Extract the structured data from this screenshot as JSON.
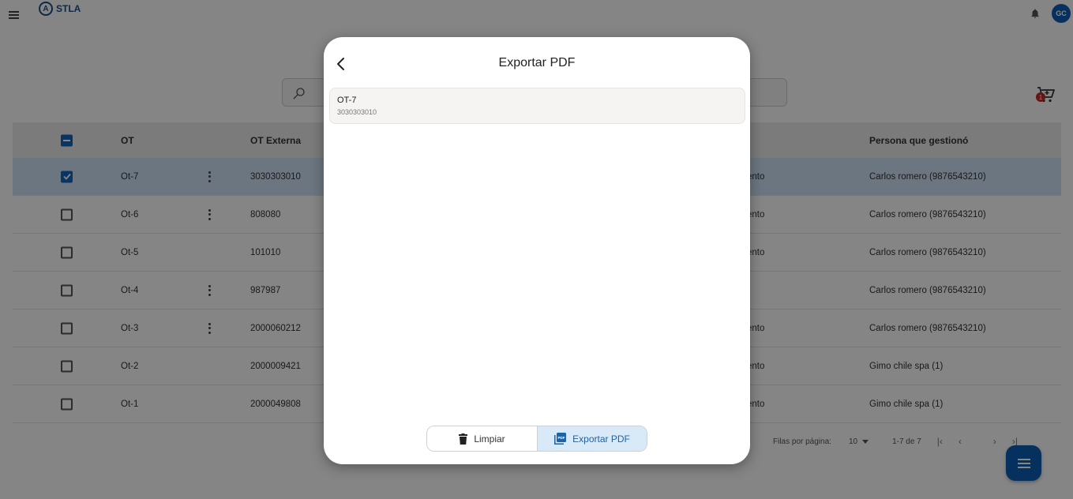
{
  "app": {
    "logo_text": "STLA",
    "avatar_initials": "GC"
  },
  "search": {
    "placeholder": ""
  },
  "cart": {
    "badge_count": "1"
  },
  "table": {
    "columns": {
      "ot": "OT",
      "ot_externa": "OT Externa",
      "persona": "Persona que gestionó"
    },
    "rows": [
      {
        "ot": "Ot-7",
        "ext": "3030303010",
        "estado": "ento",
        "persona": "Carlos romero  (9876543210)",
        "checked": true,
        "kebab": true
      },
      {
        "ot": "Ot-6",
        "ext": "808080",
        "estado": "ento",
        "persona": "Carlos romero  (9876543210)",
        "checked": false,
        "kebab": true
      },
      {
        "ot": "Ot-5",
        "ext": "101010",
        "estado": "ento",
        "persona": "Carlos romero  (9876543210)",
        "checked": false,
        "kebab": false
      },
      {
        "ot": "Ot-4",
        "ext": "987987",
        "estado": "",
        "persona": "Carlos romero  (9876543210)",
        "checked": false,
        "kebab": true
      },
      {
        "ot": "Ot-3",
        "ext": "2000060212",
        "estado": "ento",
        "persona": "Carlos romero  (9876543210)",
        "checked": false,
        "kebab": true
      },
      {
        "ot": "Ot-2",
        "ext": "2000009421",
        "estado": "ento",
        "persona": "Gimo chile spa (1)",
        "checked": false,
        "kebab": false
      },
      {
        "ot": "Ot-1",
        "ext": "2000049808",
        "estado": "ento",
        "persona": "Gimo chile spa (1)",
        "checked": false,
        "kebab": false
      }
    ]
  },
  "pagination": {
    "rows_per_page_label": "Filas por página:",
    "rows_per_page_value": "10",
    "range": "1-7 de 7"
  },
  "modal": {
    "title": "Exportar PDF",
    "items": [
      {
        "name": "OT-7",
        "ext": "3030303010"
      }
    ],
    "clear_label": "Limpiar",
    "export_label": "Exportar PDF"
  },
  "colors": {
    "primary": "#0d5eb6",
    "selected_row": "#cfe2f6",
    "export_button_bg": "#d8e9f8"
  }
}
